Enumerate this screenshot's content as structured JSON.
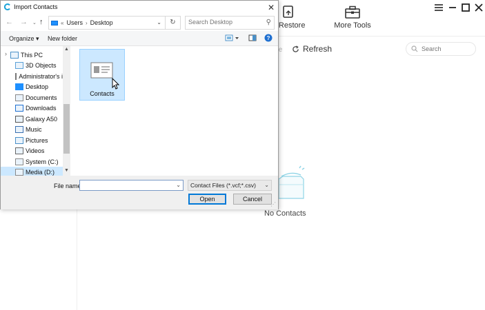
{
  "app": {
    "toolbar": {
      "backup_label": "& Restore",
      "more_tools_label": "More Tools"
    },
    "delete_fragment": "te",
    "refresh_label": "Refresh",
    "search_placeholder": "Search",
    "empty_text": "No Contacts"
  },
  "dialog": {
    "title": "Import Contacts",
    "address": {
      "recent_glyph": "«",
      "crumbs": [
        "Users",
        "Desktop"
      ]
    },
    "search_placeholder": "Search Desktop",
    "commands": {
      "organize": "Organize ▾",
      "new_folder": "New folder"
    },
    "nav_items": [
      {
        "label": "This PC",
        "icon": "computer-icon"
      },
      {
        "label": "3D Objects",
        "icon": "cube-icon"
      },
      {
        "label": "Administrator's i",
        "icon": "user-folder-icon"
      },
      {
        "label": "Desktop",
        "icon": "desktop-icon"
      },
      {
        "label": "Documents",
        "icon": "document-icon"
      },
      {
        "label": "Downloads",
        "icon": "download-icon"
      },
      {
        "label": "Galaxy A50",
        "icon": "phone-icon"
      },
      {
        "label": "Music",
        "icon": "music-icon"
      },
      {
        "label": "Pictures",
        "icon": "pictures-icon"
      },
      {
        "label": "Videos",
        "icon": "video-icon"
      },
      {
        "label": "System (C:)",
        "icon": "drive-icon"
      },
      {
        "label": "Media (D:)",
        "icon": "drive-icon"
      }
    ],
    "files": [
      {
        "label": "Contacts",
        "icon": "contact-card-icon"
      }
    ],
    "file_name_label": "File name:",
    "file_name_value": "",
    "filter_value": "Contact Files (*.vcf;*.csv)",
    "open_label": "Open",
    "cancel_label": "Cancel"
  }
}
